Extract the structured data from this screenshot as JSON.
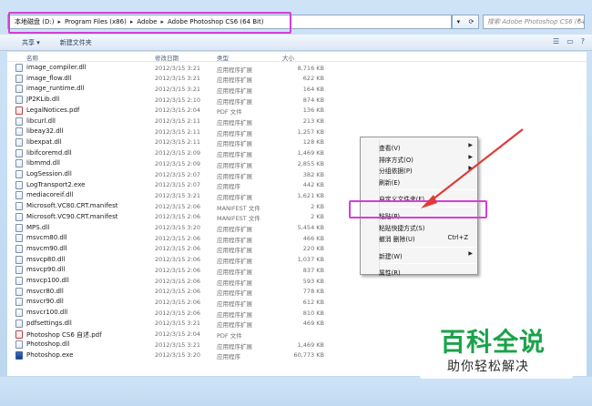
{
  "address": {
    "segments": [
      "本地磁盘 (D:)",
      "Program Files (x86)",
      "Adobe",
      "Adobe Photoshop CS6 (64 Bit)"
    ],
    "search_placeholder": "搜索 Adobe Photoshop CS6 (64 Bit)"
  },
  "toolbar": {
    "share_label": "共享 ▾",
    "new_folder_label": "新建文件夹"
  },
  "columns": {
    "name": "名称",
    "date": "修改日期",
    "type": "类型",
    "size": "大小"
  },
  "files": [
    {
      "name": "image_compiler.dll",
      "date": "2012/3/15 3:21",
      "type": "应用程序扩展",
      "size": "8,716 KB",
      "icon": "dll"
    },
    {
      "name": "image_flow.dll",
      "date": "2012/3/15 3:21",
      "type": "应用程序扩展",
      "size": "622 KB",
      "icon": "dll"
    },
    {
      "name": "image_runtime.dll",
      "date": "2012/3/15 3:21",
      "type": "应用程序扩展",
      "size": "164 KB",
      "icon": "dll"
    },
    {
      "name": "JP2KLib.dll",
      "date": "2012/3/15 2:10",
      "type": "应用程序扩展",
      "size": "874 KB",
      "icon": "dll"
    },
    {
      "name": "LegalNotices.pdf",
      "date": "2012/3/15 2:04",
      "type": "PDF 文件",
      "size": "136 KB",
      "icon": "pdf"
    },
    {
      "name": "libcurl.dll",
      "date": "2012/3/15 2:11",
      "type": "应用程序扩展",
      "size": "213 KB",
      "icon": "dll"
    },
    {
      "name": "libeay32.dll",
      "date": "2012/3/15 2:11",
      "type": "应用程序扩展",
      "size": "1,257 KB",
      "icon": "dll"
    },
    {
      "name": "libexpat.dll",
      "date": "2012/3/15 2:11",
      "type": "应用程序扩展",
      "size": "128 KB",
      "icon": "dll"
    },
    {
      "name": "libifcoremd.dll",
      "date": "2012/3/15 2:09",
      "type": "应用程序扩展",
      "size": "1,469 KB",
      "icon": "dll"
    },
    {
      "name": "libmmd.dll",
      "date": "2012/3/15 2:09",
      "type": "应用程序扩展",
      "size": "2,855 KB",
      "icon": "dll"
    },
    {
      "name": "LogSession.dll",
      "date": "2012/3/15 2:07",
      "type": "应用程序扩展",
      "size": "382 KB",
      "icon": "dll"
    },
    {
      "name": "LogTransport2.exe",
      "date": "2012/3/15 2:07",
      "type": "应用程序",
      "size": "442 KB",
      "icon": "dll"
    },
    {
      "name": "mediacoreif.dll",
      "date": "2012/3/15 3:21",
      "type": "应用程序扩展",
      "size": "1,621 KB",
      "icon": "dll"
    },
    {
      "name": "Microsoft.VC80.CRT.manifest",
      "date": "2012/3/15 2:06",
      "type": "MANIFEST 文件",
      "size": "2 KB",
      "icon": "dll"
    },
    {
      "name": "Microsoft.VC90.CRT.manifest",
      "date": "2012/3/15 2:06",
      "type": "MANIFEST 文件",
      "size": "2 KB",
      "icon": "dll"
    },
    {
      "name": "MPS.dll",
      "date": "2012/3/15 3:20",
      "type": "应用程序扩展",
      "size": "5,454 KB",
      "icon": "dll"
    },
    {
      "name": "msvcm80.dll",
      "date": "2012/3/15 2:06",
      "type": "应用程序扩展",
      "size": "466 KB",
      "icon": "dll"
    },
    {
      "name": "msvcm90.dll",
      "date": "2012/3/15 2:06",
      "type": "应用程序扩展",
      "size": "220 KB",
      "icon": "dll"
    },
    {
      "name": "msvcp80.dll",
      "date": "2012/3/15 2:06",
      "type": "应用程序扩展",
      "size": "1,037 KB",
      "icon": "dll"
    },
    {
      "name": "msvcp90.dll",
      "date": "2012/3/15 2:06",
      "type": "应用程序扩展",
      "size": "837 KB",
      "icon": "dll"
    },
    {
      "name": "msvcp100.dll",
      "date": "2012/3/15 2:06",
      "type": "应用程序扩展",
      "size": "593 KB",
      "icon": "dll"
    },
    {
      "name": "msvcr80.dll",
      "date": "2012/3/15 2:06",
      "type": "应用程序扩展",
      "size": "778 KB",
      "icon": "dll"
    },
    {
      "name": "msvcr90.dll",
      "date": "2012/3/15 2:06",
      "type": "应用程序扩展",
      "size": "612 KB",
      "icon": "dll"
    },
    {
      "name": "msvcr100.dll",
      "date": "2012/3/15 2:06",
      "type": "应用程序扩展",
      "size": "810 KB",
      "icon": "dll"
    },
    {
      "name": "pdfsettings.dll",
      "date": "2012/3/15 3:21",
      "type": "应用程序扩展",
      "size": "469 KB",
      "icon": "dll"
    },
    {
      "name": "Photoshop CS6 自述.pdf",
      "date": "2012/3/15 2:04",
      "type": "PDF 文件",
      "size": "",
      "icon": "pdf"
    },
    {
      "name": "Photoshop.dll",
      "date": "2012/3/15 3:21",
      "type": "应用程序扩展",
      "size": "1,469 KB",
      "icon": "dll"
    },
    {
      "name": "Photoshop.exe",
      "date": "2012/3/15 3:20",
      "type": "应用程序",
      "size": "60,773 KB",
      "icon": "exe"
    }
  ],
  "context_menu": [
    {
      "label": "查看(V)",
      "submenu": true
    },
    {
      "label": "排序方式(O)",
      "submenu": true
    },
    {
      "label": "分组依据(P)",
      "submenu": true
    },
    {
      "label": "刷新(E)",
      "submenu": false
    },
    {
      "separator": true
    },
    {
      "label": "自定义文件夹(F)...",
      "submenu": false
    },
    {
      "separator": true
    },
    {
      "label": "粘贴(P)",
      "submenu": false
    },
    {
      "label": "粘贴快捷方式(S)",
      "submenu": false
    },
    {
      "label": "撤消 删除(U)",
      "shortcut": "Ctrl+Z",
      "submenu": false
    },
    {
      "separator": true
    },
    {
      "label": "新建(W)",
      "submenu": true
    },
    {
      "separator": true
    },
    {
      "label": "属性(R)",
      "submenu": false
    }
  ],
  "watermark": {
    "main": "百科全说",
    "sub": "助你轻松解决"
  },
  "colors": {
    "highlight": "#d43fd4",
    "arrow": "#e23a3a",
    "watermark_green": "#1aa34a"
  }
}
